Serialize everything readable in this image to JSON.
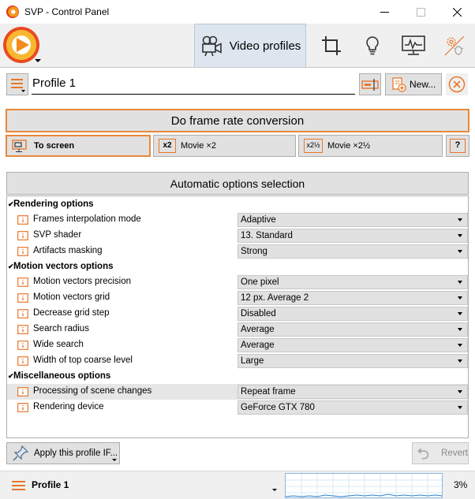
{
  "window": {
    "title": "SVP - Control Panel"
  },
  "toolbar": {
    "active_tab_label": "Video profiles",
    "tabs": [
      "crop-icon",
      "lightbulb-icon",
      "monitor-icon",
      "gear-bug-icon"
    ]
  },
  "profile": {
    "name": "Profile 1",
    "new_label": "New..."
  },
  "frc": {
    "label": "Do frame rate conversion"
  },
  "modes": {
    "to_screen": "To screen",
    "x2_badge": "x2",
    "movie_x2": "Movie ×2",
    "x2_5_badge": "x2½",
    "movie_x2_5": "Movie ×2½",
    "help_badge": "?"
  },
  "auto": {
    "label": "Automatic options selection"
  },
  "sections": [
    {
      "title": "Rendering options",
      "rows": [
        {
          "label": "Frames interpolation mode",
          "value": "Adaptive"
        },
        {
          "label": "SVP shader",
          "value": "13. Standard"
        },
        {
          "label": "Artifacts masking",
          "value": "Strong"
        }
      ]
    },
    {
      "title": "Motion vectors options",
      "rows": [
        {
          "label": "Motion vectors precision",
          "value": "One pixel"
        },
        {
          "label": "Motion vectors grid",
          "value": "12 px. Average 2"
        },
        {
          "label": "Decrease grid step",
          "value": "Disabled"
        },
        {
          "label": "Search radius",
          "value": "Average"
        },
        {
          "label": "Wide search",
          "value": "Average"
        },
        {
          "label": "Width of top coarse level",
          "value": "Large"
        }
      ]
    },
    {
      "title": "Miscellaneous options",
      "rows": [
        {
          "label": "Processing of scene changes",
          "value": "Repeat frame"
        },
        {
          "label": "Rendering device",
          "value": "GeForce GTX 780"
        }
      ]
    }
  ],
  "footer": {
    "apply_label": "Apply this profile IF...",
    "revert_label": "Revert"
  },
  "status": {
    "profile": "Profile 1",
    "cpu": "3%"
  },
  "colors": {
    "accent": "#e8883a",
    "tab_active": "#dde6ef",
    "icon_orange": "#e8772c"
  }
}
